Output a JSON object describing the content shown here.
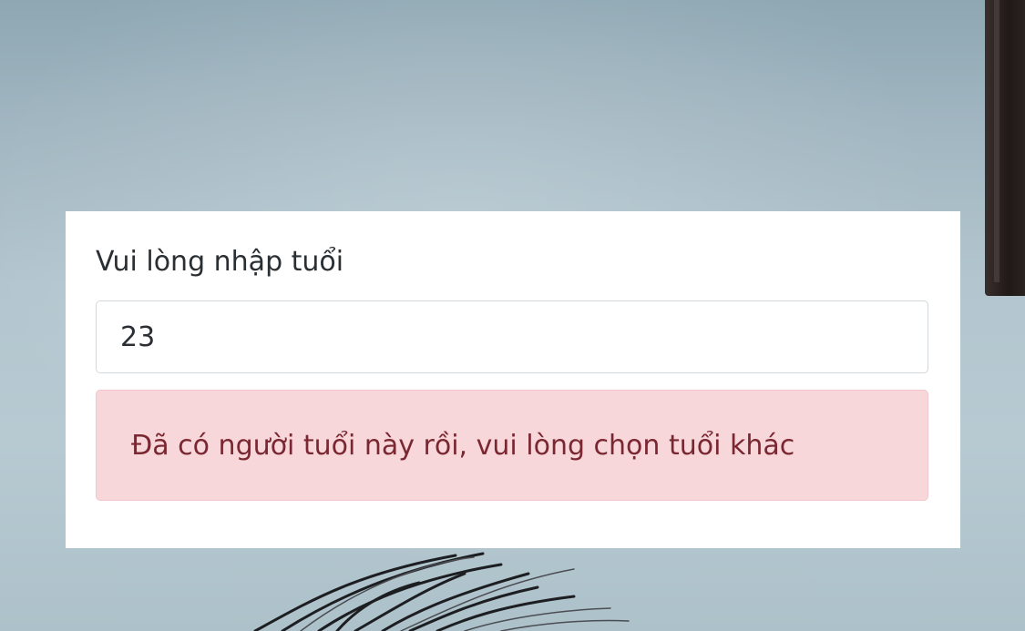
{
  "form": {
    "label": "Vui lòng nhập tuổi",
    "age_value": "23"
  },
  "alert": {
    "message": "Đã có người tuổi này rồi, vui lòng chọn tuổi khác",
    "type": "danger",
    "background_color": "#f8d7da",
    "text_color": "#7a2732"
  }
}
